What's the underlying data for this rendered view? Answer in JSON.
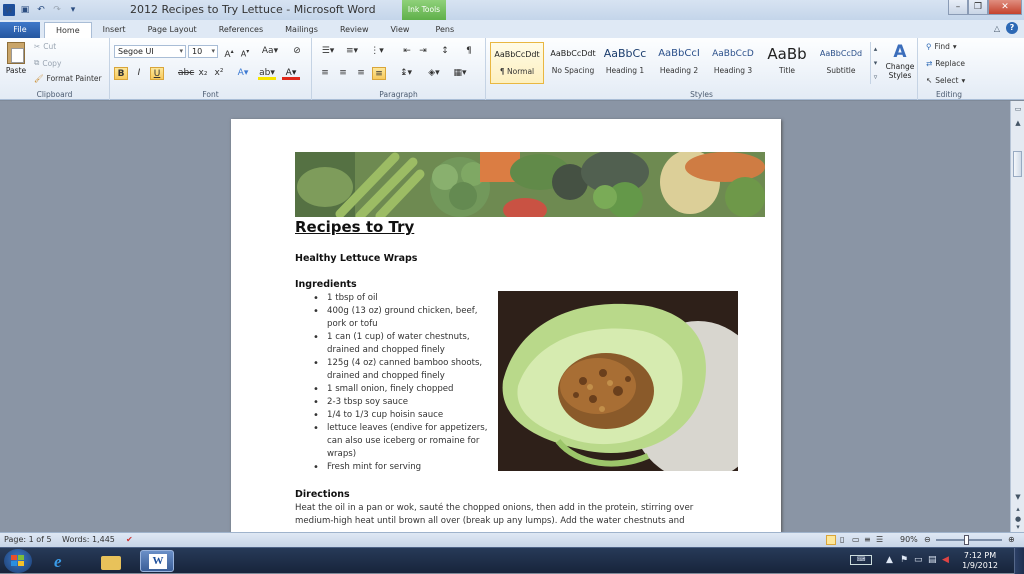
{
  "window": {
    "title": "2012 Recipes to Try Lettuce - Microsoft Word",
    "contextual_tab": "Ink Tools"
  },
  "tabs": [
    {
      "label": "File"
    },
    {
      "label": "Home"
    },
    {
      "label": "Insert"
    },
    {
      "label": "Page Layout"
    },
    {
      "label": "References"
    },
    {
      "label": "Mailings"
    },
    {
      "label": "Review"
    },
    {
      "label": "View"
    },
    {
      "label": "Pens"
    }
  ],
  "ribbon": {
    "clipboard": {
      "paste": "Paste",
      "cut": "Cut",
      "copy": "Copy",
      "format_painter": "Format Painter",
      "label": "Clipboard"
    },
    "font": {
      "family": "Segoe UI",
      "size": "10",
      "label": "Font"
    },
    "paragraph": {
      "label": "Paragraph"
    },
    "styles": {
      "label": "Styles",
      "change_styles": "Change Styles",
      "items": [
        {
          "sample": "AaBbCcDdt",
          "name": "¶ Normal"
        },
        {
          "sample": "AaBbCcDdt",
          "name": "No Spacing"
        },
        {
          "sample": "AaBbCc",
          "name": "Heading 1"
        },
        {
          "sample": "AaBbCcI",
          "name": "Heading 2"
        },
        {
          "sample": "AaBbCcD",
          "name": "Heading 3"
        },
        {
          "sample": "AaBb",
          "name": "Title"
        },
        {
          "sample": "AaBbCcDd",
          "name": "Subtitle"
        }
      ]
    },
    "editing": {
      "find": "Find",
      "replace": "Replace",
      "select": "Select",
      "label": "Editing"
    }
  },
  "document": {
    "heading": "Recipes to Try",
    "recipe_title": "Healthy Lettuce Wraps",
    "ingredients_heading": "Ingredients",
    "ingredients": [
      "1 tbsp of oil",
      "400g (13 oz) ground chicken, beef, pork or tofu",
      "1 can (1 cup) of water chestnuts, drained and chopped finely",
      "125g (4 oz) canned bamboo shoots, drained and chopped finely",
      "1 small onion, finely chopped",
      "2-3 tbsp soy sauce",
      "1/4 to 1/3 cup hoisin sauce",
      "lettuce leaves (endive for appetizers, can also use iceberg or romaine for wraps)",
      "Fresh mint for serving"
    ],
    "directions_heading": "Directions",
    "directions_text": "Heat the oil in a pan or wok, sauté the chopped onions, then add in the protein, stirring over medium-high heat until brown all over (break up any lumps). Add the water chestnuts and"
  },
  "status": {
    "page": "Page: 1 of 5",
    "words": "Words: 1,445",
    "zoom": "90%"
  },
  "clock": {
    "time": "7:12 PM",
    "date": "1/9/2012"
  }
}
